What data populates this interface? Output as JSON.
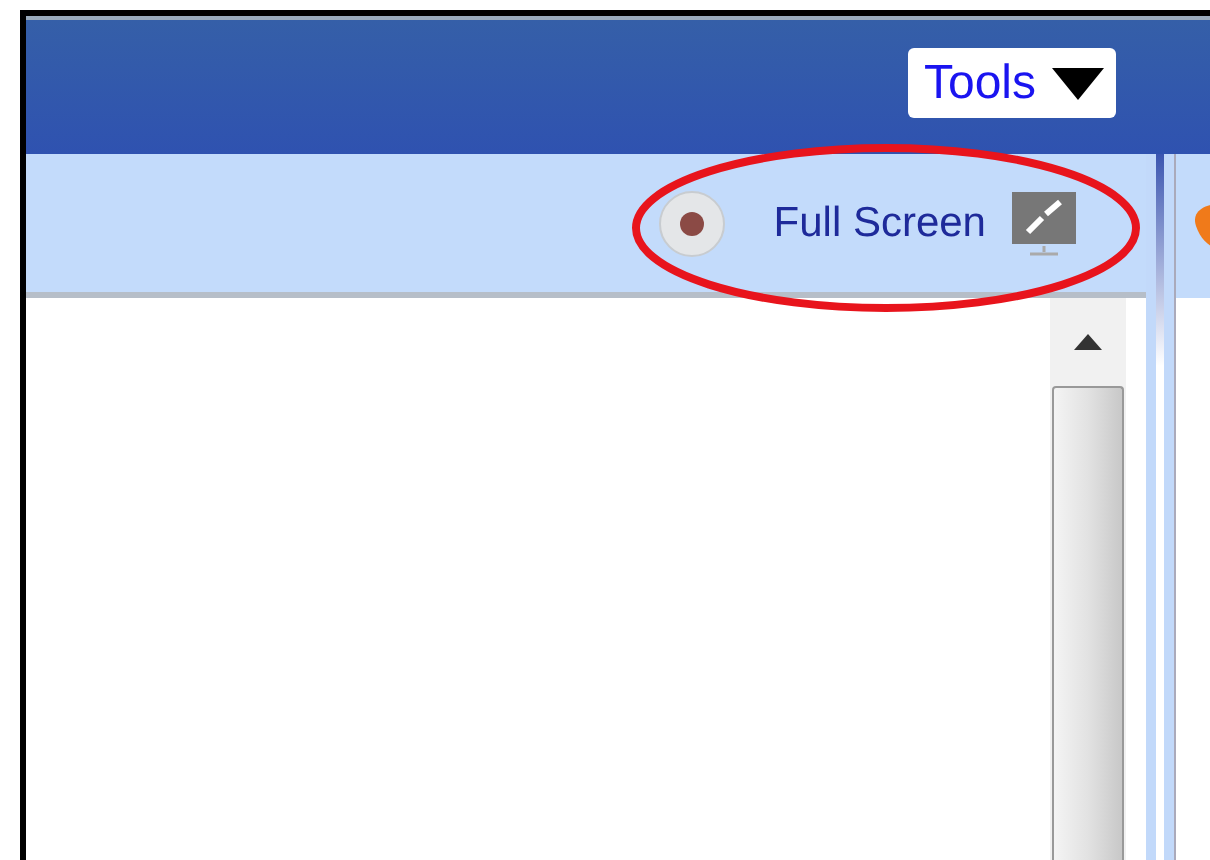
{
  "header": {
    "tools_button": {
      "label": "Tools"
    }
  },
  "toolbar": {
    "full_screen": {
      "label": "Full Screen"
    }
  }
}
